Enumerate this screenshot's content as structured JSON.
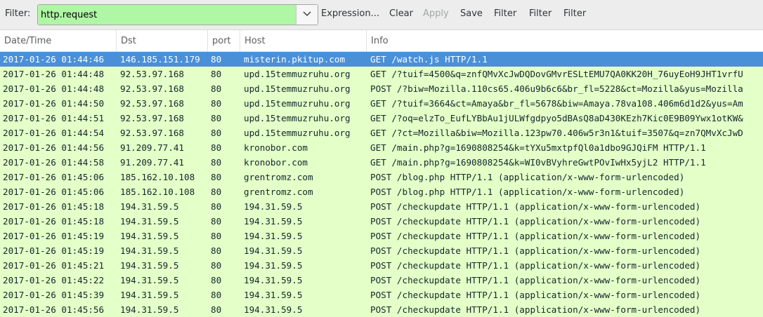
{
  "toolbar": {
    "filter_label": "Filter:",
    "filter_value": "http.request",
    "expression_label": "Expression...",
    "clear_label": "Clear",
    "apply_label": "Apply",
    "save_label": "Save",
    "filter_btn_1": "Filter",
    "filter_btn_2": "Filter",
    "filter_btn_3": "Filter"
  },
  "table": {
    "columns": [
      "Date/Time",
      "Dst",
      "port",
      "Host",
      "Info"
    ],
    "row_color": "#e4ffc7",
    "selected_color": "#4a90d9",
    "rows": [
      {
        "time": "2017-01-26 01:44:46",
        "dst": "146.185.151.179",
        "port": "80",
        "host": "misterin.pkitup.com",
        "info": "GET /watch.js HTTP/1.1",
        "selected": true
      },
      {
        "time": "2017-01-26 01:44:48",
        "dst": "92.53.97.168",
        "port": "80",
        "host": "upd.15temmuzruhu.org",
        "info": "GET /?tuif=4500&q=znfQMvXcJwDQDovGMvrESLtEMU7QA0KK20H_76uyEoH9JHT1vrfU"
      },
      {
        "time": "2017-01-26 01:44:48",
        "dst": "92.53.97.168",
        "port": "80",
        "host": "upd.15temmuzruhu.org",
        "info": "POST /?biw=Mozilla.110cs65.406u9b6c6&br_fl=5228&ct=Mozilla&yus=Mozilla"
      },
      {
        "time": "2017-01-26 01:44:50",
        "dst": "92.53.97.168",
        "port": "80",
        "host": "upd.15temmuzruhu.org",
        "info": "GET /?tuif=3664&ct=Amaya&br_fl=5678&biw=Amaya.78va108.406m6d1d2&yus=Am"
      },
      {
        "time": "2017-01-26 01:44:51",
        "dst": "92.53.97.168",
        "port": "80",
        "host": "upd.15temmuzruhu.org",
        "info": "GET /?oq=elzTo_EufLYBbAu1jULWfgdpyo5dBAsQ8aD430KEzh7Kic0E9B09Ywx1otKW&"
      },
      {
        "time": "2017-01-26 01:44:54",
        "dst": "92.53.97.168",
        "port": "80",
        "host": "upd.15temmuzruhu.org",
        "info": "GET /?ct=Mozilla&biw=Mozilla.123pw70.406w5r3n1&tuif=3507&q=zn7QMvXcJwD"
      },
      {
        "time": "2017-01-26 01:44:56",
        "dst": "91.209.77.41",
        "port": "80",
        "host": "kronobor.com",
        "info": "GET /main.php?g=1690808254&k=tYXu5mxtpfQl0a1dbo9GJQiFM HTTP/1.1"
      },
      {
        "time": "2017-01-26 01:44:58",
        "dst": "91.209.77.41",
        "port": "80",
        "host": "kronobor.com",
        "info": "GET /main.php?g=1690808254&k=WI0vBVyhreGwtPOvIwHx5yjL2 HTTP/1.1"
      },
      {
        "time": "2017-01-26 01:45:06",
        "dst": "185.162.10.108",
        "port": "80",
        "host": "grentromz.com",
        "info": "POST /blog.php HTTP/1.1  (application/x-www-form-urlencoded)"
      },
      {
        "time": "2017-01-26 01:45:06",
        "dst": "185.162.10.108",
        "port": "80",
        "host": "grentromz.com",
        "info": "POST /blog.php HTTP/1.1  (application/x-www-form-urlencoded)"
      },
      {
        "time": "2017-01-26 01:45:18",
        "dst": "194.31.59.5",
        "port": "80",
        "host": "194.31.59.5",
        "info": "POST /checkupdate HTTP/1.1  (application/x-www-form-urlencoded)"
      },
      {
        "time": "2017-01-26 01:45:18",
        "dst": "194.31.59.5",
        "port": "80",
        "host": "194.31.59.5",
        "info": "POST /checkupdate HTTP/1.1  (application/x-www-form-urlencoded)"
      },
      {
        "time": "2017-01-26 01:45:19",
        "dst": "194.31.59.5",
        "port": "80",
        "host": "194.31.59.5",
        "info": "POST /checkupdate HTTP/1.1  (application/x-www-form-urlencoded)"
      },
      {
        "time": "2017-01-26 01:45:19",
        "dst": "194.31.59.5",
        "port": "80",
        "host": "194.31.59.5",
        "info": "POST /checkupdate HTTP/1.1  (application/x-www-form-urlencoded)"
      },
      {
        "time": "2017-01-26 01:45:21",
        "dst": "194.31.59.5",
        "port": "80",
        "host": "194.31.59.5",
        "info": "POST /checkupdate HTTP/1.1  (application/x-www-form-urlencoded)"
      },
      {
        "time": "2017-01-26 01:45:22",
        "dst": "194.31.59.5",
        "port": "80",
        "host": "194.31.59.5",
        "info": "POST /checkupdate HTTP/1.1  (application/x-www-form-urlencoded)"
      },
      {
        "time": "2017-01-26 01:45:39",
        "dst": "194.31.59.5",
        "port": "80",
        "host": "194.31.59.5",
        "info": "POST /checkupdate HTTP/1.1  (application/x-www-form-urlencoded)"
      },
      {
        "time": "2017-01-26 01:45:56",
        "dst": "194.31.59.5",
        "port": "80",
        "host": "194.31.59.5",
        "info": "POST /checkupdate HTTP/1.1  (application/x-www-form-urlencoded)"
      }
    ]
  }
}
